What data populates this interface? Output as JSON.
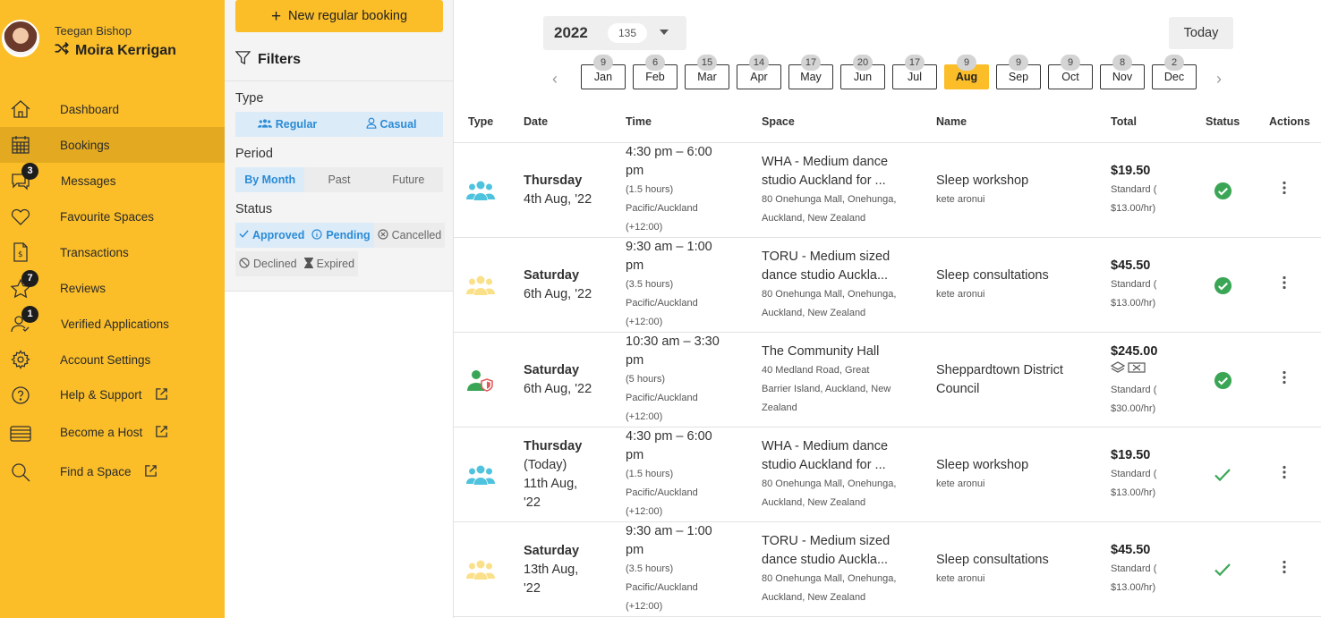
{
  "user": {
    "name": "Teegan Bishop",
    "active_account": "Moira Kerrigan"
  },
  "nav": {
    "dashboard": "Dashboard",
    "bookings": "Bookings",
    "messages": "Messages",
    "messages_badge": "3",
    "favourites": "Favourite Spaces",
    "transactions": "Transactions",
    "reviews": "Reviews",
    "reviews_badge": "7",
    "verified": "Verified Applications",
    "verified_badge": "1",
    "account": "Account Settings",
    "help": "Help & Support",
    "host": "Become a Host",
    "find": "Find a Space"
  },
  "filters": {
    "new_booking": "New regular booking",
    "title": "Filters",
    "type_title": "Type",
    "type_regular": "Regular",
    "type_casual": "Casual",
    "period_title": "Period",
    "period_month": "By Month",
    "period_past": "Past",
    "period_future": "Future",
    "status_title": "Status",
    "status_approved": "Approved",
    "status_pending": "Pending",
    "status_cancelled": "Cancelled",
    "status_declined": "Declined",
    "status_expired": "Expired"
  },
  "calendar": {
    "year": "2022",
    "year_count": "135",
    "today": "Today",
    "months": [
      {
        "label": "Jan",
        "count": "9"
      },
      {
        "label": "Feb",
        "count": "6"
      },
      {
        "label": "Mar",
        "count": "15"
      },
      {
        "label": "Apr",
        "count": "14"
      },
      {
        "label": "May",
        "count": "17"
      },
      {
        "label": "Jun",
        "count": "20"
      },
      {
        "label": "Jul",
        "count": "17"
      },
      {
        "label": "Aug",
        "count": "9"
      },
      {
        "label": "Sep",
        "count": "9"
      },
      {
        "label": "Oct",
        "count": "9"
      },
      {
        "label": "Nov",
        "count": "8"
      },
      {
        "label": "Dec",
        "count": "2"
      }
    ],
    "selected_month": "Aug"
  },
  "table": {
    "headers": {
      "type": "Type",
      "date": "Date",
      "time": "Time",
      "space": "Space",
      "name": "Name",
      "total": "Total",
      "status": "Status",
      "actions": "Actions"
    },
    "rows": [
      {
        "type_icon": "group-icon",
        "type_color": "#4FC3DE",
        "day": "Thursday",
        "date_lines": [
          "4th Aug, '22"
        ],
        "time_lines": [
          "4:30 pm – 6:00",
          "pm"
        ],
        "duration": "(1.5 hours)",
        "tz1": "Pacific/Auckland",
        "tz2": "(+12:00)",
        "space_lines": [
          "WHA - Medium dance",
          "studio Auckland for ..."
        ],
        "addr_lines": [
          "80 Onehunga Mall, Onehunga,",
          "Auckland, New Zealand"
        ],
        "name": "Sleep workshop",
        "name_sub": "kete aronui",
        "total": "$19.50",
        "rate_label": "Standard (",
        "rate": "$13.00/hr)",
        "status_icon": "check-circle-icon"
      },
      {
        "type_icon": "group-icon",
        "type_color": "#FBE08A",
        "day": "Saturday",
        "date_lines": [
          "6th Aug, '22"
        ],
        "time_lines": [
          "9:30 am – 1:00",
          "pm"
        ],
        "duration": "(3.5 hours)",
        "tz1": "Pacific/Auckland",
        "tz2": "(+12:00)",
        "space_lines": [
          "TORU - Medium sized",
          "dance studio Auckla..."
        ],
        "addr_lines": [
          "80 Onehunga Mall, Onehunga,",
          "Auckland, New Zealand"
        ],
        "name": "Sleep consultations",
        "name_sub": "kete aronui",
        "total": "$45.50",
        "rate_label": "Standard (",
        "rate": "$13.00/hr)",
        "status_icon": "check-circle-icon"
      },
      {
        "type_icon": "user-shield-icon",
        "type_color": "#3AA655",
        "day": "Saturday",
        "date_lines": [
          "6th Aug, '22"
        ],
        "time_lines": [
          "10:30 am – 3:30",
          "pm"
        ],
        "duration": "(5 hours)",
        "tz1": "Pacific/Auckland",
        "tz2": "(+12:00)",
        "space_lines": [
          "The Community Hall"
        ],
        "addr_lines": [
          "40 Medland Road, Great",
          "Barrier Island, Auckland, New",
          "Zealand"
        ],
        "name_lines": [
          "Sheppardtown District",
          "Council"
        ],
        "name": "",
        "name_sub": "",
        "total": "$245.00",
        "rate_label": "Standard (",
        "rate": "$30.00/hr)",
        "status_icon": "check-circle-icon"
      },
      {
        "type_icon": "group-icon",
        "type_color": "#4FC3DE",
        "day": "Thursday",
        "date_lines": [
          "(Today)",
          "11th Aug,",
          "'22"
        ],
        "time_lines": [
          "4:30 pm – 6:00",
          "pm"
        ],
        "duration": "(1.5 hours)",
        "tz1": "Pacific/Auckland",
        "tz2": "(+12:00)",
        "space_lines": [
          "WHA - Medium dance",
          "studio Auckland for ..."
        ],
        "addr_lines": [
          "80 Onehunga Mall, Onehunga,",
          "Auckland, New Zealand"
        ],
        "name": "Sleep workshop",
        "name_sub": "kete aronui",
        "total": "$19.50",
        "rate_label": "Standard (",
        "rate": "$13.00/hr)",
        "status_icon": "check-icon"
      },
      {
        "type_icon": "group-icon",
        "type_color": "#FBE08A",
        "day": "Saturday",
        "date_lines": [
          "13th Aug,",
          "'22"
        ],
        "time_lines": [
          "9:30 am – 1:00",
          "pm"
        ],
        "duration": "(3.5 hours)",
        "tz1": "Pacific/Auckland",
        "tz2": "(+12:00)",
        "space_lines": [
          "TORU - Medium sized",
          "dance studio Auckla..."
        ],
        "addr_lines": [
          "80 Onehunga Mall, Onehunga,",
          "Auckland, New Zealand"
        ],
        "name": "Sleep consultations",
        "name_sub": "kete aronui",
        "total": "$45.50",
        "rate_label": "Standard (",
        "rate": "$13.00/hr)",
        "status_icon": "check-icon"
      }
    ]
  },
  "colors": {
    "brand": "#FBBE28",
    "sidebar_active": "#E3AA21",
    "accent_blue": "#2A8BD6",
    "success": "#3AA655"
  }
}
